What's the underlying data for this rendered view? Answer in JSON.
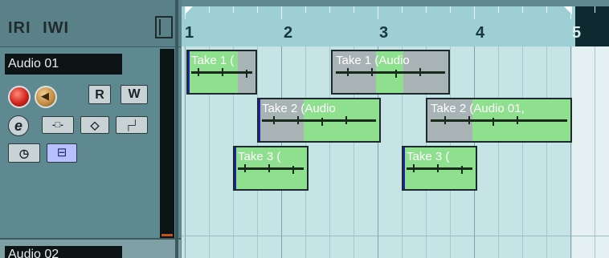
{
  "toolbar": {
    "r_label": "IRI",
    "w_label": "IWI"
  },
  "tracks": [
    {
      "name": "Audio 01",
      "buttons": {
        "read": "R",
        "write": "W",
        "edit": "e"
      }
    },
    {
      "name": "Audio 02"
    }
  ],
  "ruler": {
    "bars": [
      "1",
      "2",
      "3",
      "4",
      "5"
    ]
  },
  "clips": [
    {
      "label": "Take 1 (",
      "lane": 1
    },
    {
      "label": "Take 1 (Audio",
      "lane": 1
    },
    {
      "label": "Take 2 (Audio",
      "lane": 2
    },
    {
      "label": "Take 2 (Audio 01,",
      "lane": 2
    },
    {
      "label": "Take 3 (",
      "lane": 3
    },
    {
      "label": "Take 3 (",
      "lane": 3
    }
  ],
  "colors": {
    "clip_active": "#8ee08e",
    "clip_inactive": "#a8b3b5",
    "record": "#d0241c",
    "ruler": "#9ecfd5"
  }
}
